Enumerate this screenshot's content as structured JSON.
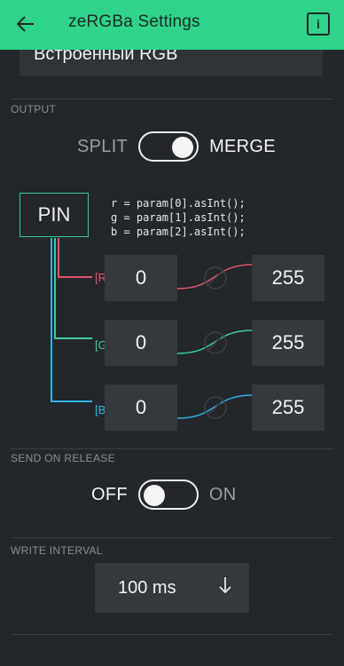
{
  "appbar": {
    "title": "zeRGBa Settings",
    "back_icon": "arrow-left-icon",
    "info_label": "i"
  },
  "device": {
    "value": "Встроенный RGB"
  },
  "output": {
    "section_label": "OUTPUT",
    "left_label": "SPLIT",
    "right_label": "MERGE",
    "state": "MERGE"
  },
  "mapping": {
    "pin_label": "PIN",
    "code": "r = param[0].asInt();\ng = param[1].asInt();\nb = param[2].asInt();",
    "channels": [
      {
        "label": "[R]",
        "min": "0",
        "max": "255",
        "color": "#e0566a"
      },
      {
        "label": "[G]",
        "min": "0",
        "max": "255",
        "color": "#3ecaa0"
      },
      {
        "label": "[B]",
        "min": "0",
        "max": "255",
        "color": "#2fb3e6"
      }
    ]
  },
  "send_on_release": {
    "section_label": "SEND ON RELEASE",
    "off_label": "OFF",
    "on_label": "ON",
    "state": "OFF"
  },
  "write_interval": {
    "section_label": "WRITE INTERVAL",
    "value": "100 ms",
    "dropdown_icon": "arrow-down-icon"
  },
  "colors": {
    "accent": "#2fd48a",
    "background": "#23262b",
    "field": "#35383d"
  }
}
